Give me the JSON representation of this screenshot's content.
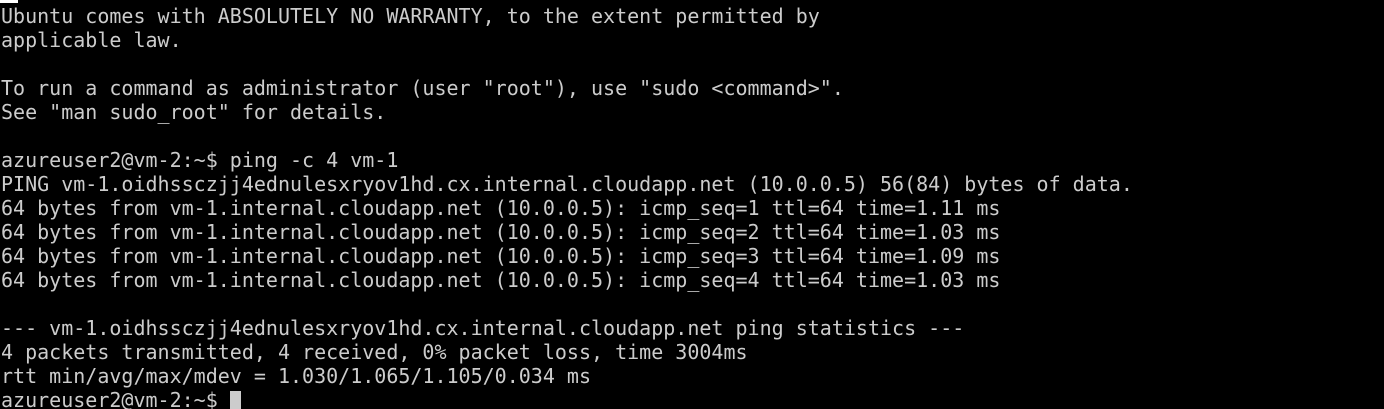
{
  "terminal": {
    "lines": [
      "Ubuntu comes with ABSOLUTELY NO WARRANTY, to the extent permitted by",
      "applicable law.",
      "",
      "To run a command as administrator (user \"root\"), use \"sudo <command>\".",
      "See \"man sudo_root\" for details.",
      "",
      "azureuser2@vm-2:~$ ping -c 4 vm-1",
      "PING vm-1.oidhssczjj4ednulesxryov1hd.cx.internal.cloudapp.net (10.0.0.5) 56(84) bytes of data.",
      "64 bytes from vm-1.internal.cloudapp.net (10.0.0.5): icmp_seq=1 ttl=64 time=1.11 ms",
      "64 bytes from vm-1.internal.cloudapp.net (10.0.0.5): icmp_seq=2 ttl=64 time=1.03 ms",
      "64 bytes from vm-1.internal.cloudapp.net (10.0.0.5): icmp_seq=3 ttl=64 time=1.09 ms",
      "64 bytes from vm-1.internal.cloudapp.net (10.0.0.5): icmp_seq=4 ttl=64 time=1.03 ms",
      "",
      "--- vm-1.oidhssczjj4ednulesxryov1hd.cx.internal.cloudapp.net ping statistics ---",
      "4 packets transmitted, 4 received, 0% packet loss, time 3004ms",
      "rtt min/avg/max/mdev = 1.030/1.065/1.105/0.034 ms"
    ],
    "prompt": "azureuser2@vm-2:~$ "
  },
  "colors": {
    "background": "#000000",
    "foreground": "#cccccc"
  }
}
